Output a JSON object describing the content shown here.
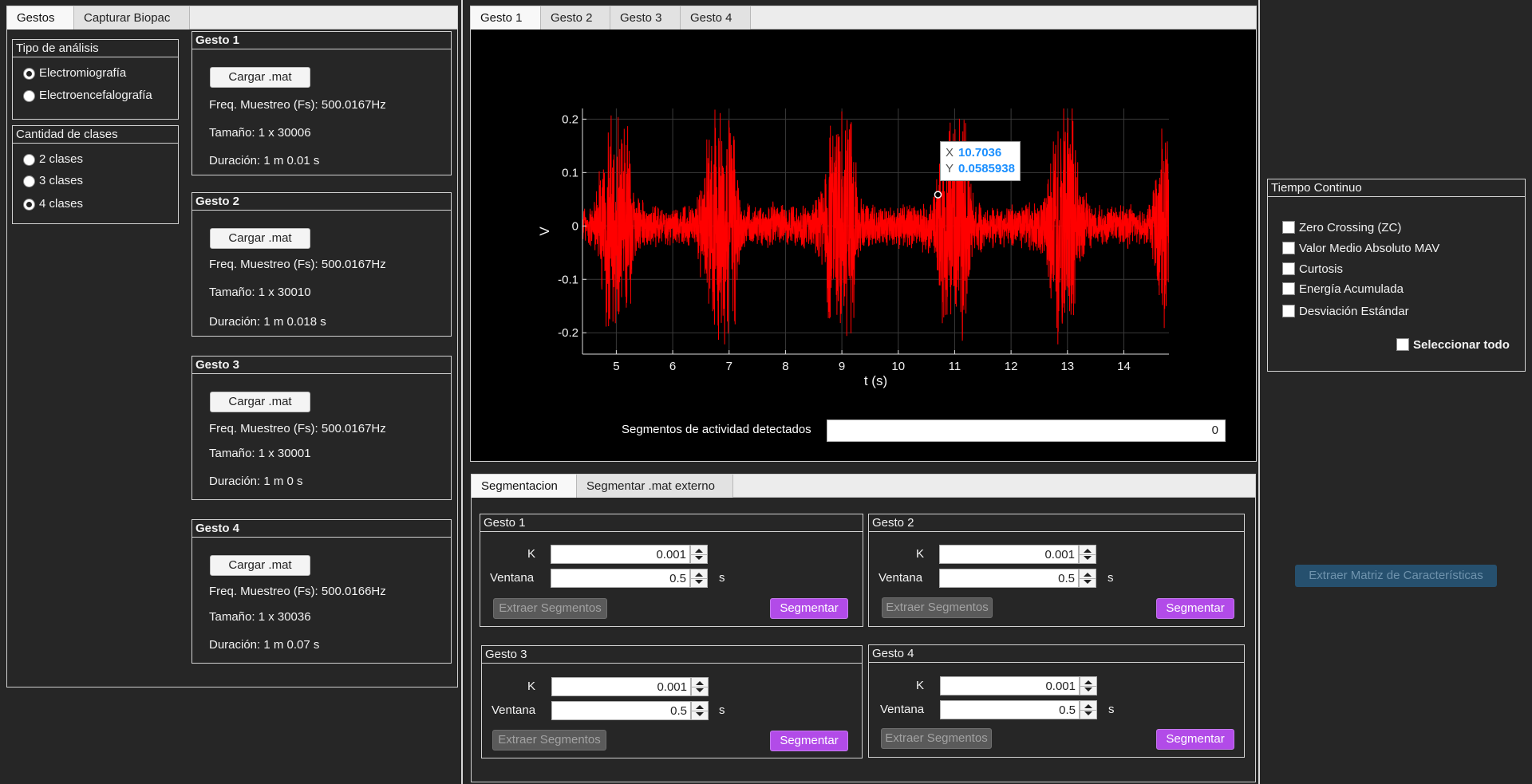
{
  "left_tabs": [
    "Gestos",
    "Capturar Biopac"
  ],
  "analysis": {
    "title": "Tipo de análisis",
    "options": [
      "Electromiografía",
      "Electroencefalografía"
    ],
    "selected": 0
  },
  "classes": {
    "title": "Cantidad de clases",
    "options": [
      "2 clases",
      "3 clases",
      "4 clases"
    ],
    "selected": 2
  },
  "gestures": [
    {
      "title": "Gesto 1",
      "load_label": "Cargar .mat",
      "fs": "Freq. Muestreo (Fs): 500.0167Hz",
      "size": "Tamaño: 1 x 30006",
      "duration": "Duración: 1 m 0.01 s"
    },
    {
      "title": "Gesto 2",
      "load_label": "Cargar .mat",
      "fs": "Freq. Muestreo (Fs): 500.0167Hz",
      "size": "Tamaño: 1 x 30010",
      "duration": "Duración: 1 m 0.018 s"
    },
    {
      "title": "Gesto 3",
      "load_label": "Cargar .mat",
      "fs": "Freq. Muestreo (Fs): 500.0167Hz",
      "size": "Tamaño: 1 x 30001",
      "duration": "Duración: 1 m 0 s"
    },
    {
      "title": "Gesto 4",
      "load_label": "Cargar .mat",
      "fs": "Freq. Muestreo (Fs): 500.0166Hz",
      "size": "Tamaño: 1 x 30036",
      "duration": "Duración: 1 m 0.07 s"
    }
  ],
  "plot_tabs": [
    "Gesto 1",
    "Gesto 2",
    "Gesto 3",
    "Gesto 4"
  ],
  "datatip": {
    "x_label": "X",
    "x_value": "10.7036",
    "y_label": "Y",
    "y_value": "0.0585938"
  },
  "segments": {
    "label": "Segmentos de actividad detectados",
    "value": "0"
  },
  "seg_tabs": [
    "Segmentacion",
    "Segmentar .mat externo"
  ],
  "seg_panels": [
    {
      "title": "Gesto 1",
      "k_label": "K",
      "k_value": "0.001",
      "win_label": "Ventana",
      "win_value": "0.5",
      "unit": "s",
      "extract_label": "Extraer Segmentos",
      "segment_label": "Segmentar"
    },
    {
      "title": "Gesto 2",
      "k_label": "K",
      "k_value": "0.001",
      "win_label": "Ventana",
      "win_value": "0.5",
      "unit": "s",
      "extract_label": "Extraer Segmentos",
      "segment_label": "Segmentar"
    },
    {
      "title": "Gesto 3",
      "k_label": "K",
      "k_value": "0.001",
      "win_label": "Ventana",
      "win_value": "0.5",
      "unit": "s",
      "extract_label": "Extraer Segmentos",
      "segment_label": "Segmentar"
    },
    {
      "title": "Gesto 4",
      "k_label": "K",
      "k_value": "0.001",
      "win_label": "Ventana",
      "win_value": "0.5",
      "unit": "s",
      "extract_label": "Extraer Segmentos",
      "segment_label": "Segmentar"
    }
  ],
  "features": {
    "title": "Tiempo Continuo",
    "options": [
      "Zero Crossing (ZC)",
      "Valor Medio Absoluto MAV",
      "Curtosis",
      "Energía Acumulada",
      "Desviación Estándar"
    ],
    "select_all": "Seleccionar todo"
  },
  "extract_matrix_label": "Extraer Matriz de Características",
  "colors": {
    "signal": "#ff0000",
    "accent_button": "#b24be8",
    "disabled_blue": "#26506e",
    "plot_bg": "#000000",
    "datatip_value": "#1a8fff"
  },
  "chart_data": {
    "type": "line",
    "title": "",
    "xlabel": "t (s)",
    "ylabel": "V",
    "xlim": [
      4.4,
      14.8
    ],
    "ylim": [
      -0.24,
      0.22
    ],
    "xticks": [
      5,
      6,
      7,
      8,
      9,
      10,
      11,
      12,
      13,
      14
    ],
    "yticks": [
      0.2,
      0.1,
      0,
      -0.1,
      -0.2
    ],
    "ytick_labels": [
      "0.2",
      "0.1",
      "0",
      "-0.1",
      "-0.2"
    ],
    "grid": true,
    "series": [
      {
        "color": "#ff0000",
        "x": [
          4.4,
          4.6,
          4.8,
          4.9,
          5.0,
          5.1,
          5.2,
          5.3,
          5.5,
          5.8,
          6.1,
          6.4,
          6.6,
          6.7,
          6.8,
          6.9,
          7.0,
          7.1,
          7.2,
          7.3,
          7.5,
          7.8,
          8.1,
          8.4,
          8.6,
          8.8,
          8.9,
          9.0,
          9.1,
          9.2,
          9.3,
          9.5,
          9.8,
          10.1,
          10.4,
          10.6,
          10.8,
          10.9,
          11.0,
          11.1,
          11.2,
          11.3,
          11.5,
          11.8,
          12.1,
          12.4,
          12.6,
          12.8,
          12.9,
          13.0,
          13.1,
          13.2,
          13.4,
          13.7,
          14.0,
          14.3,
          14.5,
          14.7
        ],
        "amplitude": [
          0.04,
          0.05,
          0.2,
          0.24,
          0.25,
          0.25,
          0.24,
          0.08,
          0.05,
          0.04,
          0.04,
          0.05,
          0.18,
          0.24,
          0.25,
          0.25,
          0.24,
          0.22,
          0.06,
          0.05,
          0.04,
          0.05,
          0.04,
          0.05,
          0.08,
          0.22,
          0.25,
          0.25,
          0.25,
          0.24,
          0.06,
          0.05,
          0.04,
          0.05,
          0.05,
          0.06,
          0.22,
          0.25,
          0.25,
          0.25,
          0.24,
          0.07,
          0.05,
          0.04,
          0.05,
          0.05,
          0.08,
          0.23,
          0.25,
          0.25,
          0.25,
          0.1,
          0.05,
          0.04,
          0.05,
          0.04,
          0.06,
          0.25
        ]
      }
    ]
  }
}
